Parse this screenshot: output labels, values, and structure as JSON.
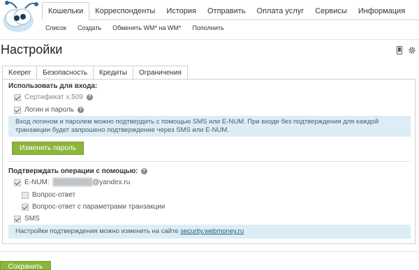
{
  "nav": {
    "items": [
      "Кошельки",
      "Корреспонденты",
      "История",
      "Отправить",
      "Оплата услуг",
      "Сервисы",
      "Информация"
    ],
    "sub_items": [
      "Список",
      "Создать",
      "Обменять WM* на WM*",
      "Пополнить"
    ]
  },
  "page": {
    "title": "Настройки"
  },
  "tabs": [
    "Keeper",
    "Безопасность",
    "Кредиты",
    "Ограничения"
  ],
  "login": {
    "title": "Использовать для входа:",
    "cert_label": "Сертификат x.509",
    "password_label": "Логин и пароль",
    "info": "Вход логином и паролем можно подтвердить с помощью SMS или E-NUM. При входе без подтверждения для каждой транзакции будет запрошено подтверждение через SMS или E-NUM.",
    "change_password_button": "Изменить пароль"
  },
  "confirm": {
    "title": "Подтверждать операции с помощью:",
    "enum_label": "E-NUM:",
    "enum_email_hidden": "████████",
    "enum_email_domain": "@yandex.ru",
    "question_label": "Вопрос-ответ",
    "question_params_label": "Вопрос-ответ с параметрами транзакции",
    "sms_label": "SMS",
    "info_text": "Настройки подтверждения можно изменить на сайте",
    "info_link": "security.webmoney.ru"
  },
  "save_button": "Сохранить",
  "colors": {
    "accent_green": "#8bb63b",
    "info_bg": "#dcedf5",
    "link": "#1c5b85"
  },
  "icons": [
    "webmoney-bug-logo-icon",
    "mobile-phone-icon",
    "gear-icon",
    "help-icon",
    "check-icon"
  ]
}
